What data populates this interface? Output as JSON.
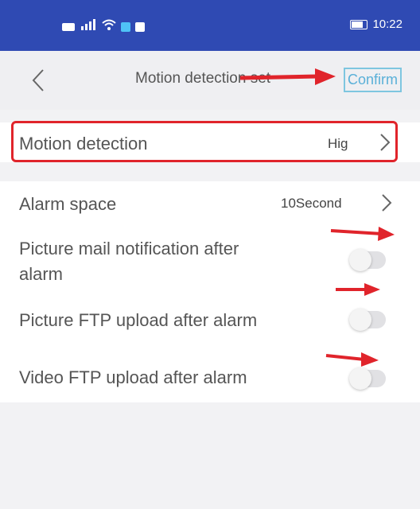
{
  "status_bar": {
    "time": "10:22"
  },
  "nav": {
    "title": "Motion detection set",
    "confirm_label": "Confirm"
  },
  "settings": {
    "motion_detection": {
      "label": "Motion detection",
      "value": "Hig"
    },
    "alarm_space": {
      "label": "Alarm space",
      "value": "10Second"
    },
    "picture_mail": {
      "label_line1": "Picture mail notification after",
      "label_line2": "alarm",
      "enabled": false
    },
    "picture_ftp": {
      "label": "Picture FTP upload after alarm",
      "enabled": false
    },
    "video_ftp": {
      "label": "Video FTP upload after alarm",
      "enabled": false
    }
  },
  "colors": {
    "status_bar": "#2f4ab3",
    "annotation_red": "#e0242b",
    "confirm_blue": "#5ab0d8"
  }
}
